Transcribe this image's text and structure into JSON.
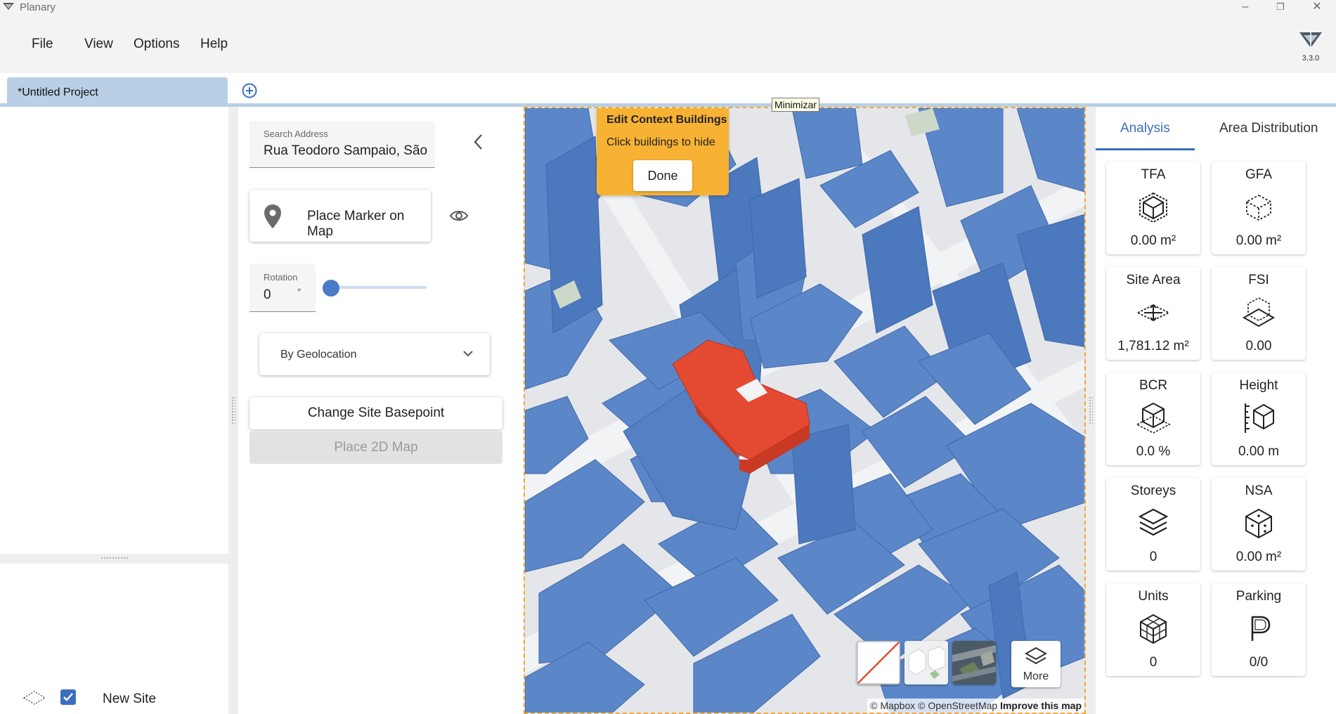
{
  "window": {
    "title": "Planary",
    "version": "3.3.0"
  },
  "menu": [
    "File",
    "View",
    "Options",
    "Help"
  ],
  "tabs": {
    "project": "*Untitled Project"
  },
  "left_panel": {
    "site_label": "New Site",
    "site_checked": true
  },
  "controls": {
    "search_label": "Search Address",
    "search_value": "Rua Teodoro Sampaio, São",
    "place_marker": "Place Marker on Map",
    "rotation_label": "Rotation",
    "rotation_value": "0",
    "rotation_unit": "°",
    "geo_select": "By Geolocation",
    "change_basepoint": "Change Site Basepoint",
    "place_2d_map": "Place 2D Map"
  },
  "map": {
    "tooltip": "Minimizar",
    "edit_title": "Edit Context Buildings",
    "edit_hint": "Click buildings to hide",
    "done": "Done",
    "more": "More",
    "attribution": "© Mapbox © OpenStreetMap",
    "improve": "Improve this map",
    "colors": {
      "building": "#5b87c9",
      "selected": "#e44a32",
      "panel": "#f7b234"
    }
  },
  "analysis": {
    "tabs": [
      "Analysis",
      "Area Distribution"
    ],
    "cards": [
      {
        "title": "TFA",
        "value": "0.00 m²",
        "icon": "cube-icon"
      },
      {
        "title": "GFA",
        "value": "0.00 m²",
        "icon": "dashed-cube-icon"
      },
      {
        "title": "Site Area",
        "value": "1,781.12 m²",
        "icon": "site-area-icon"
      },
      {
        "title": "FSI",
        "value": "0.00",
        "icon": "fsi-cube-icon"
      },
      {
        "title": "BCR",
        "value": "0.0 %",
        "icon": "bcr-cube-icon"
      },
      {
        "title": "Height",
        "value": "0.00 m",
        "icon": "height-icon"
      },
      {
        "title": "Storeys",
        "value": "0",
        "icon": "layers-icon"
      },
      {
        "title": "NSA",
        "value": "0.00 m²",
        "icon": "nsa-cube-icon"
      },
      {
        "title": "Units",
        "value": "0",
        "icon": "units-grid-icon"
      },
      {
        "title": "Parking",
        "value": "0/0",
        "icon": "parking-icon"
      }
    ]
  }
}
